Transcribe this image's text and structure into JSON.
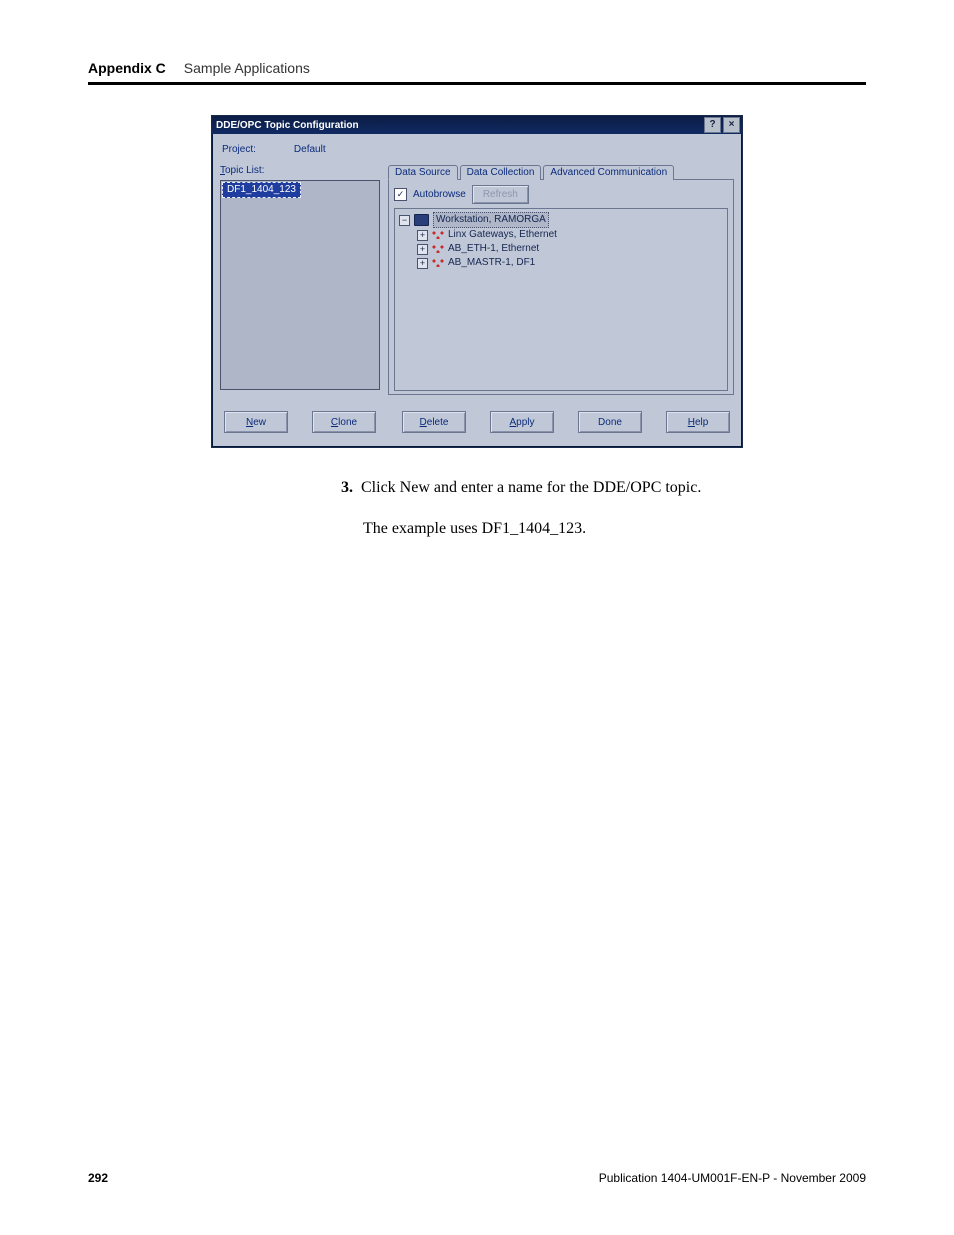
{
  "header": {
    "appendix_label": "Appendix C",
    "section_title": "Sample Applications"
  },
  "dialog": {
    "title": "DDE/OPC Topic Configuration",
    "close_glyph": "×",
    "help_glyph": "?",
    "project_label": "Project:",
    "project_value": "Default",
    "topic_list_label_pre": "T",
    "topic_list_label_post": "opic List:",
    "topic_item": "DF1_1404_123",
    "tabs": {
      "data_source": "Data Source",
      "data_collection": "Data Collection",
      "adv_comm": "Advanced Communication"
    },
    "autobrowse_label": "Autobrowse",
    "refresh_label": "Refresh",
    "tree": {
      "root_minus": "−",
      "root_label": "Workstation, RAMORGA",
      "n1_plus": "+",
      "n1_label": "Linx Gateways, Ethernet",
      "n2_plus": "+",
      "n2_label": "AB_ETH-1, Ethernet",
      "n3_plus": "+",
      "n3_label": "AB_MASTR-1, DF1"
    },
    "buttons": {
      "new": "New",
      "new_u": "N",
      "clone": "Clone",
      "clone_u": "C",
      "delete": "Delete",
      "delete_u": "D",
      "apply": "Apply",
      "apply_u": "A",
      "done": "Done",
      "help": "Help",
      "help_u": "H"
    }
  },
  "body": {
    "step_num": "3.",
    "step_text": "Click New and enter a name for the DDE/OPC topic.",
    "example_text": "The example uses DF1_1404_123."
  },
  "footer": {
    "page": "292",
    "pub": "Publication 1404-UM001F-EN-P - November 2009"
  }
}
